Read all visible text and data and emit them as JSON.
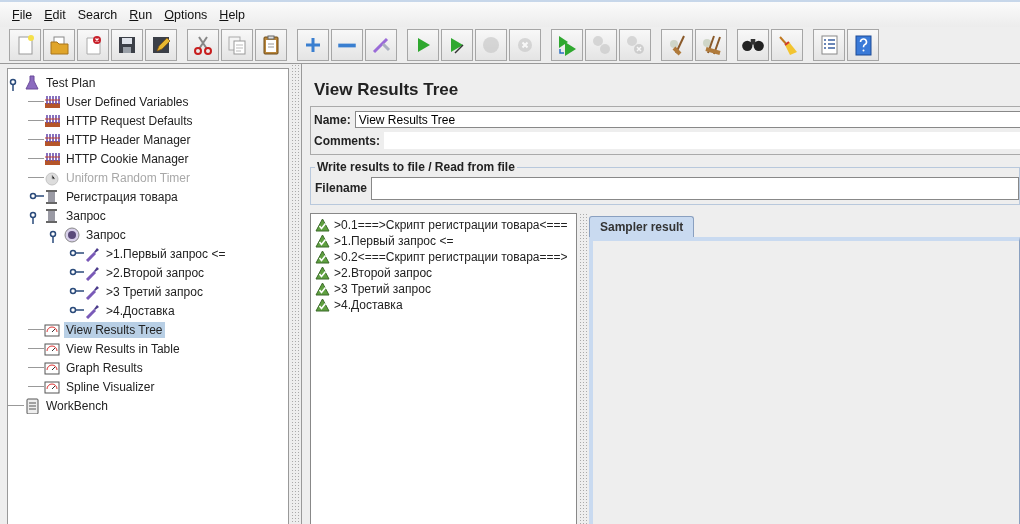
{
  "menu": [
    {
      "label": "File",
      "mnemonic": true
    },
    {
      "label": "Edit",
      "mnemonic": true
    },
    {
      "label": "Search",
      "mnemonic": false
    },
    {
      "label": "Run",
      "mnemonic": true
    },
    {
      "label": "Options",
      "mnemonic": true
    },
    {
      "label": "Help",
      "mnemonic": true
    }
  ],
  "toolbar": [
    [
      {
        "kind": "new",
        "disabled": false
      },
      {
        "kind": "open",
        "disabled": false
      },
      {
        "kind": "close",
        "disabled": false
      },
      {
        "kind": "save",
        "disabled": false
      },
      {
        "kind": "save-as",
        "disabled": false
      }
    ],
    [
      {
        "kind": "cut",
        "disabled": false
      },
      {
        "kind": "copy",
        "disabled": false
      },
      {
        "kind": "paste",
        "disabled": false
      }
    ],
    [
      {
        "kind": "expand",
        "disabled": false
      },
      {
        "kind": "collapse",
        "disabled": false
      },
      {
        "kind": "toggle",
        "disabled": false
      }
    ],
    [
      {
        "kind": "start",
        "disabled": false
      },
      {
        "kind": "start-no-pause",
        "disabled": false
      },
      {
        "kind": "stop",
        "disabled": true
      },
      {
        "kind": "shutdown",
        "disabled": true
      }
    ],
    [
      {
        "kind": "remote-start",
        "disabled": false
      },
      {
        "kind": "remote-stop",
        "disabled": true
      },
      {
        "kind": "remote-shutdown",
        "disabled": true
      }
    ],
    [
      {
        "kind": "clear",
        "disabled": false
      },
      {
        "kind": "clear-all",
        "disabled": false
      }
    ],
    [
      {
        "kind": "search",
        "disabled": false
      },
      {
        "kind": "reset-search",
        "disabled": false
      }
    ],
    [
      {
        "kind": "function-helper",
        "disabled": false
      },
      {
        "kind": "help",
        "disabled": false
      }
    ]
  ],
  "tree": [
    {
      "label": "Test Plan",
      "kind": "plan",
      "expanded": true,
      "disabled": false,
      "selected": false,
      "children": [
        {
          "label": "User Defined Variables",
          "kind": "config",
          "disabled": false,
          "selected": false
        },
        {
          "label": "HTTP Request Defaults",
          "kind": "config",
          "disabled": false,
          "selected": false
        },
        {
          "label": "HTTP Header Manager",
          "kind": "config",
          "disabled": false,
          "selected": false
        },
        {
          "label": "HTTP Cookie Manager",
          "kind": "config",
          "disabled": false,
          "selected": false
        },
        {
          "label": "Uniform Random Timer",
          "kind": "timer",
          "disabled": true,
          "selected": false
        },
        {
          "label": "Регистрация товара",
          "kind": "thread-group",
          "expanded": false,
          "disabled": false,
          "selected": false
        },
        {
          "label": "Запрос",
          "kind": "thread-group",
          "expanded": true,
          "disabled": false,
          "selected": false,
          "children": [
            {
              "label": "Запрос",
              "kind": "controller",
              "expanded": true,
              "disabled": false,
              "selected": false,
              "children": [
                {
                  "label": ">1.Первый запрос <=",
                  "kind": "sampler",
                  "expanded": false,
                  "disabled": false,
                  "selected": false
                },
                {
                  "label": ">2.Второй запрос",
                  "kind": "sampler",
                  "expanded": false,
                  "disabled": false,
                  "selected": false
                },
                {
                  "label": ">3 Третий запрос",
                  "kind": "sampler",
                  "expanded": false,
                  "disabled": false,
                  "selected": false
                },
                {
                  "label": ">4.Доставка",
                  "kind": "sampler",
                  "expanded": false,
                  "disabled": false,
                  "selected": false
                }
              ]
            }
          ]
        },
        {
          "label": "View Results Tree",
          "kind": "listener",
          "disabled": false,
          "selected": true
        },
        {
          "label": "View Results in Table",
          "kind": "listener",
          "disabled": false,
          "selected": false
        },
        {
          "label": "Graph Results",
          "kind": "listener",
          "disabled": false,
          "selected": false
        },
        {
          "label": "Spline Visualizer",
          "kind": "listener",
          "disabled": false,
          "selected": false
        }
      ]
    },
    {
      "label": "WorkBench",
      "kind": "workbench",
      "disabled": false,
      "selected": false
    }
  ],
  "panel": {
    "title": "View Results Tree",
    "name_label": "Name:",
    "name_value": "View Results Tree",
    "comments_label": "Comments:",
    "file_group": {
      "legend": "Write results to file / Read from file",
      "filename_label": "Filename"
    },
    "results": [
      ">0.1===>Скрипт регистрации товара<===",
      ">1.Первый запрос <=",
      ">0.2<===Скрипт регистрации товара===>",
      ">2.Второй запрос",
      ">3 Третий запрос",
      ">4.Доставка"
    ],
    "tabs": [
      {
        "label": "Sampler result",
        "selected": true
      }
    ]
  }
}
